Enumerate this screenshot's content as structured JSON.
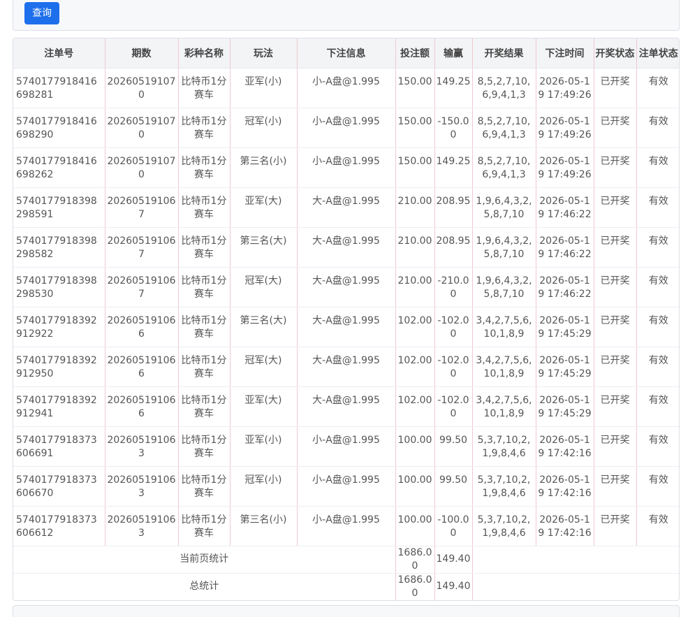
{
  "search": {
    "query_label": "查询"
  },
  "table": {
    "headers": [
      "注单号",
      "期数",
      "彩种名称",
      "玩法",
      "下注信息",
      "投注额",
      "输赢",
      "开奖结果",
      "下注时间",
      "开奖状态",
      "注单状态"
    ],
    "rows": [
      [
        "5740177918416698281",
        "202605191070",
        "比特币1分赛车",
        "亚军(小)",
        "小-A盘@1.995",
        "150.00",
        "149.25",
        "8,5,2,7,10,6,9,4,1,3",
        "2026-05-19 17:49:26",
        "已开奖",
        "有效"
      ],
      [
        "5740177918416698290",
        "202605191070",
        "比特币1分赛车",
        "冠军(小)",
        "小-A盘@1.995",
        "150.00",
        "-150.00",
        "8,5,2,7,10,6,9,4,1,3",
        "2026-05-19 17:49:26",
        "已开奖",
        "有效"
      ],
      [
        "5740177918416698262",
        "202605191070",
        "比特币1分赛车",
        "第三名(小)",
        "小-A盘@1.995",
        "150.00",
        "149.25",
        "8,5,2,7,10,6,9,4,1,3",
        "2026-05-19 17:49:26",
        "已开奖",
        "有效"
      ],
      [
        "5740177918398298591",
        "202605191067",
        "比特币1分赛车",
        "亚军(大)",
        "大-A盘@1.995",
        "210.00",
        "208.95",
        "1,9,6,4,3,2,5,8,7,10",
        "2026-05-19 17:46:22",
        "已开奖",
        "有效"
      ],
      [
        "5740177918398298582",
        "202605191067",
        "比特币1分赛车",
        "第三名(大)",
        "大-A盘@1.995",
        "210.00",
        "208.95",
        "1,9,6,4,3,2,5,8,7,10",
        "2026-05-19 17:46:22",
        "已开奖",
        "有效"
      ],
      [
        "5740177918398298530",
        "202605191067",
        "比特币1分赛车",
        "冠军(大)",
        "大-A盘@1.995",
        "210.00",
        "-210.00",
        "1,9,6,4,3,2,5,8,7,10",
        "2026-05-19 17:46:22",
        "已开奖",
        "有效"
      ],
      [
        "5740177918392912922",
        "202605191066",
        "比特币1分赛车",
        "第三名(大)",
        "大-A盘@1.995",
        "102.00",
        "-102.00",
        "3,4,2,7,5,6,10,1,8,9",
        "2026-05-19 17:45:29",
        "已开奖",
        "有效"
      ],
      [
        "5740177918392912950",
        "202605191066",
        "比特币1分赛车",
        "冠军(大)",
        "大-A盘@1.995",
        "102.00",
        "-102.00",
        "3,4,2,7,5,6,10,1,8,9",
        "2026-05-19 17:45:29",
        "已开奖",
        "有效"
      ],
      [
        "5740177918392912941",
        "202605191066",
        "比特币1分赛车",
        "亚军(大)",
        "大-A盘@1.995",
        "102.00",
        "-102.00",
        "3,4,2,7,5,6,10,1,8,9",
        "2026-05-19 17:45:29",
        "已开奖",
        "有效"
      ],
      [
        "5740177918373606691",
        "202605191063",
        "比特币1分赛车",
        "亚军(小)",
        "小-A盘@1.995",
        "100.00",
        "99.50",
        "5,3,7,10,2,1,9,8,4,6",
        "2026-05-19 17:42:16",
        "已开奖",
        "有效"
      ],
      [
        "5740177918373606670",
        "202605191063",
        "比特币1分赛车",
        "冠军(小)",
        "小-A盘@1.995",
        "100.00",
        "99.50",
        "5,3,7,10,2,1,9,8,4,6",
        "2026-05-19 17:42:16",
        "已开奖",
        "有效"
      ],
      [
        "5740177918373606612",
        "202605191063",
        "比特币1分赛车",
        "第三名(小)",
        "小-A盘@1.995",
        "100.00",
        "-100.00",
        "5,3,7,10,2,1,9,8,4,6",
        "2026-05-19 17:42:16",
        "已开奖",
        "有效"
      ]
    ],
    "page_total": {
      "label": "当前页统计",
      "amount": "1686.00",
      "win_loss": "149.40"
    },
    "grand_total": {
      "label": "总统计",
      "amount": "1686.00",
      "win_loss": "149.40"
    }
  },
  "colors": {
    "primary_button": "#1e6fec",
    "header_bg": "#f3f4f6",
    "column_divider": "#f0c9cf"
  }
}
